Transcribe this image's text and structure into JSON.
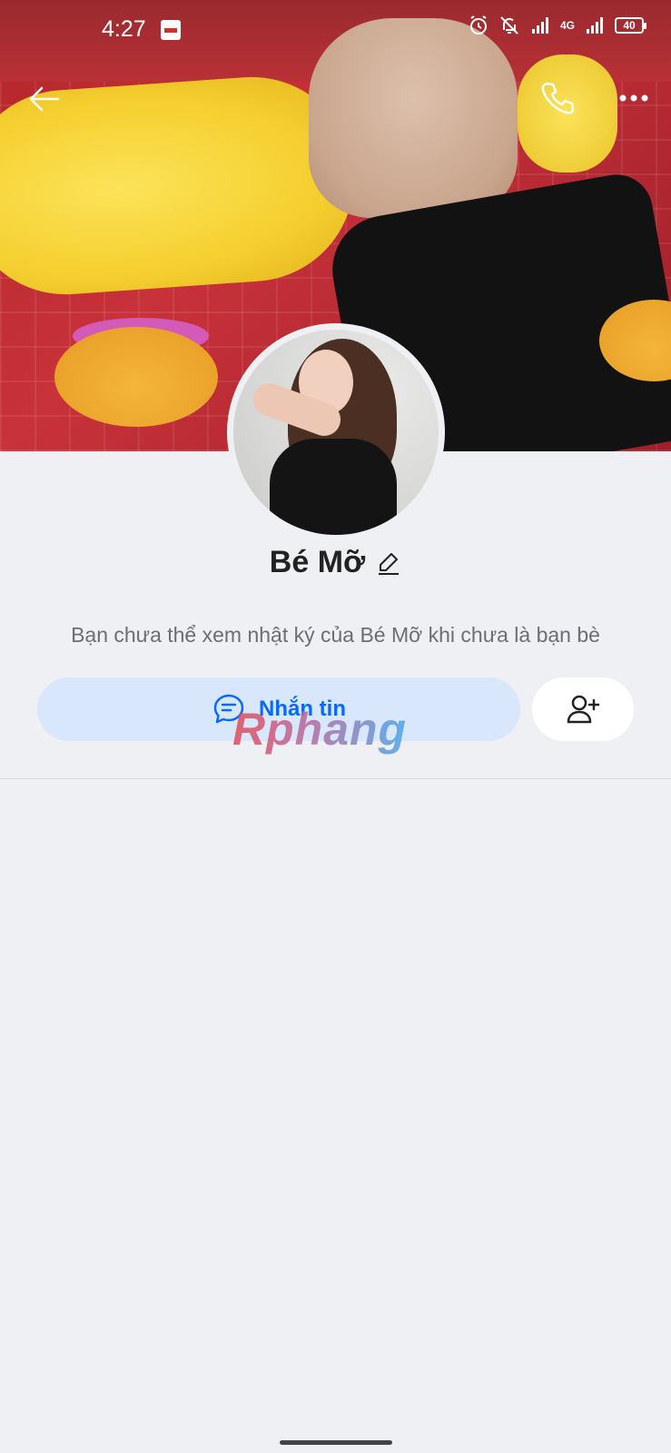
{
  "status_bar": {
    "time": "4:27",
    "battery": "40",
    "network": "4G",
    "icons": [
      "app-notification-icon",
      "alarm-icon",
      "bell-muted-icon",
      "signal-icon",
      "signal-icon",
      "battery-icon"
    ]
  },
  "header": {
    "back_icon": "arrow-left-icon",
    "call_icon": "phone-icon",
    "more_icon": "more-dots-icon"
  },
  "profile": {
    "name": "Bé Mỡ",
    "edit_icon": "pencil-icon",
    "notice": "Bạn chưa thể xem nhật ký của Bé Mỡ khi chưa là bạn bè"
  },
  "actions": {
    "message_label": "Nhắn tin",
    "message_icon": "chat-bubble-icon",
    "add_friend_icon": "add-user-icon"
  },
  "watermark": "Rphang",
  "colors": {
    "accent": "#0a68ff",
    "message_bg": "#d8e7fb",
    "page_bg": "#eff0f4"
  }
}
